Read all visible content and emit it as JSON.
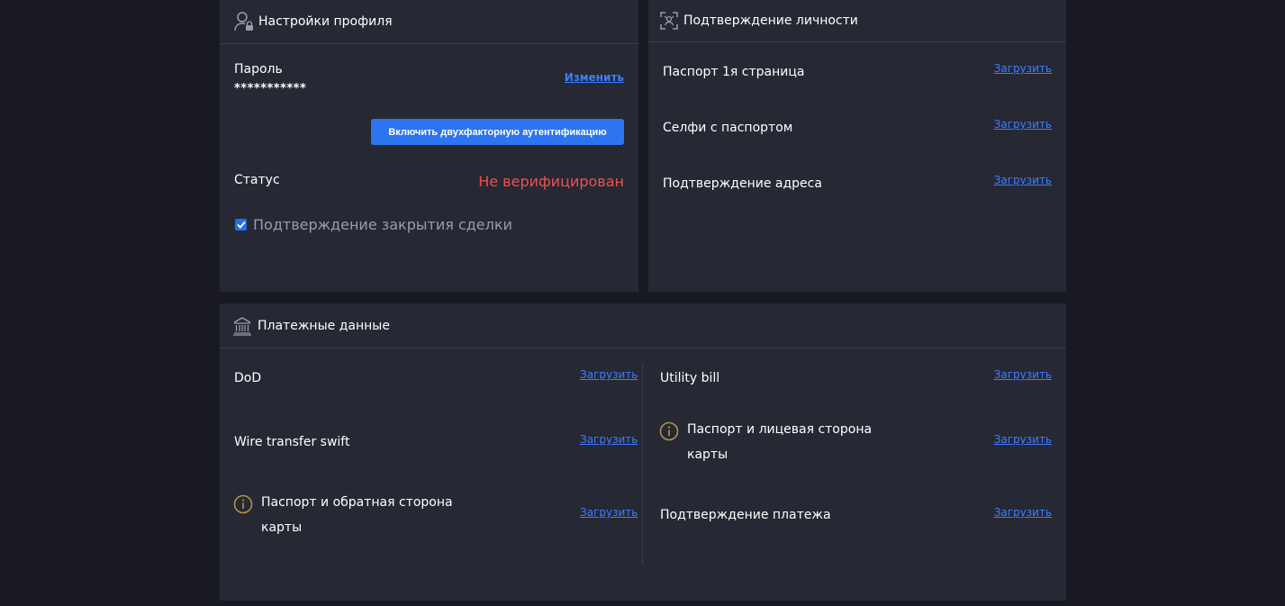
{
  "profile": {
    "title": "Настройки профиля",
    "icon": "user-lock-icon",
    "password_label": "Пароль",
    "password_value": "***********",
    "change_link": "Изменить",
    "twofa_button": "Включить двухфакторную аутентификацию",
    "status_label": "Статус",
    "status_value": "Не верифицирован",
    "status_color": "#ec5151",
    "deal_confirm_label": "Подтверждение закрытия сделки",
    "deal_confirm_checked": true
  },
  "identity": {
    "title": "Подтверждение личности",
    "icon": "face-scan-icon",
    "items": [
      {
        "label": "Паспорт 1я страница",
        "action": "Загрузить"
      },
      {
        "label": "Селфи с паспортом",
        "action": "Загрузить"
      },
      {
        "label": "Подтверждение адреса",
        "action": "Загрузить"
      }
    ]
  },
  "payment": {
    "title": "Платежные данные",
    "icon": "bank-icon",
    "left_items": [
      {
        "label": "DoD",
        "action": "Загрузить"
      },
      {
        "label": "Wire transfer swift",
        "action": "Загрузить"
      },
      {
        "label_line1": "Паспорт и обратная сторона",
        "label_line2": "карты",
        "action": "Загрузить",
        "info_icon": "info-icon"
      }
    ],
    "right_items": [
      {
        "label": "Utility bill",
        "action": "Загрузить"
      },
      {
        "label_line1": "Паспорт и лицевая сторона",
        "label_line2": "карты",
        "action": "Загрузить",
        "info_icon": "info-icon"
      },
      {
        "label": "Подтверждение платежа",
        "action": "Загрузить"
      }
    ]
  },
  "colors": {
    "page_bg": "#181922",
    "panel_bg": "#262834",
    "accent": "#2d74f0",
    "link": "#3d7eff",
    "error": "#ec5151",
    "info": "#b5964a"
  }
}
